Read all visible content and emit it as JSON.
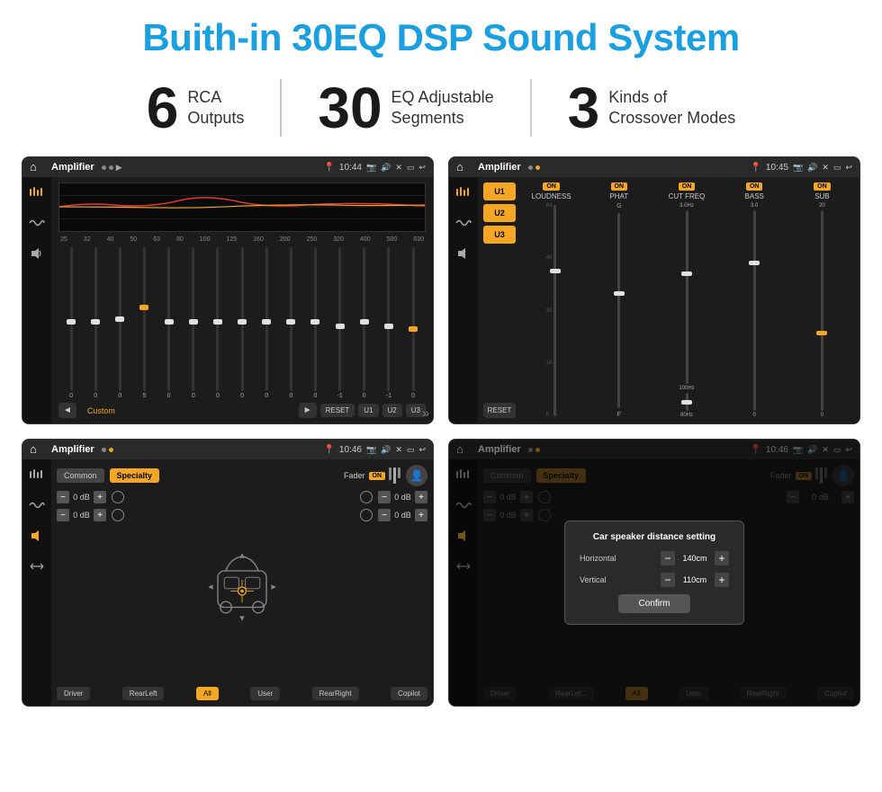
{
  "page": {
    "title": "Buith-in 30EQ DSP Sound System",
    "stats": [
      {
        "number": "6",
        "label": "RCA\nOutputs"
      },
      {
        "number": "30",
        "label": "EQ Adjustable\nSegments"
      },
      {
        "number": "3",
        "label": "Kinds of\nCrossover Modes"
      }
    ]
  },
  "screen1": {
    "status_bar": {
      "title": "Amplifier",
      "time": "10:44"
    },
    "freq_labels": [
      "25",
      "32",
      "40",
      "50",
      "63",
      "80",
      "100",
      "125",
      "160",
      "200",
      "250",
      "320",
      "400",
      "500",
      "630"
    ],
    "slider_values": [
      "0",
      "0",
      "0",
      "5",
      "0",
      "0",
      "0",
      "0",
      "0",
      "0",
      "0",
      "-1",
      "0",
      "-1"
    ],
    "bottom_buttons": [
      "◄",
      "Custom",
      "►",
      "RESET",
      "U1",
      "U2",
      "U3"
    ]
  },
  "screen2": {
    "status_bar": {
      "title": "Amplifier",
      "time": "10:45"
    },
    "u_buttons": [
      "U1",
      "U2",
      "U3"
    ],
    "controls": [
      {
        "on": true,
        "name": "LOUDNESS"
      },
      {
        "on": true,
        "name": "PHAT"
      },
      {
        "on": true,
        "name": "CUT FREQ"
      },
      {
        "on": true,
        "name": "BASS"
      },
      {
        "on": true,
        "name": "SUB"
      }
    ],
    "reset_label": "RESET"
  },
  "screen3": {
    "status_bar": {
      "title": "Amplifier",
      "time": "10:46"
    },
    "tabs": [
      "Common",
      "Specialty"
    ],
    "fader_label": "Fader",
    "on_label": "ON",
    "volumes": [
      "0 dB",
      "0 dB",
      "0 dB",
      "0 dB"
    ],
    "bottom_buttons": [
      "Driver",
      "RearLeft",
      "All",
      "User",
      "RearRight",
      "Copilot"
    ]
  },
  "screen4": {
    "status_bar": {
      "title": "Amplifier",
      "time": "10:46"
    },
    "tabs": [
      "Common",
      "Specialty"
    ],
    "fader_label": "Fader",
    "on_label": "ON",
    "dialog": {
      "title": "Car speaker distance setting",
      "horizontal_label": "Horizontal",
      "horizontal_value": "140cm",
      "vertical_label": "Vertical",
      "vertical_value": "110cm",
      "confirm_label": "Confirm"
    },
    "volumes": [
      "0 dB",
      "0 dB"
    ],
    "bottom_buttons": [
      "Driver",
      "RearLef...",
      "All",
      "User",
      "RearRight",
      "Copilot"
    ]
  }
}
